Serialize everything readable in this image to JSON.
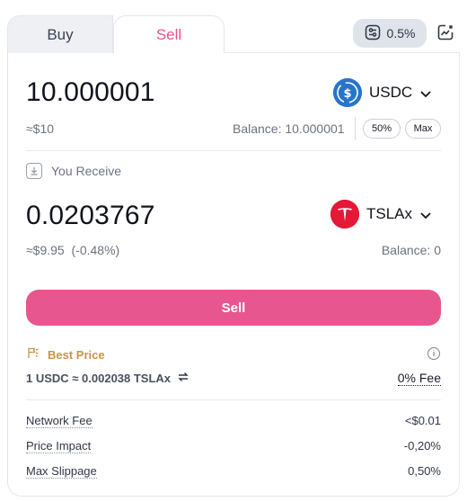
{
  "tabs": {
    "buy": "Buy",
    "sell": "Sell",
    "active": "sell"
  },
  "slippage": {
    "value": "0.5%"
  },
  "pay": {
    "amount": "10.000001",
    "usd_value": "≈$10",
    "balance": "Balance: 10.000001",
    "token": {
      "symbol": "USDC",
      "icon": "usdc-icon",
      "color": "#2775ca"
    },
    "pct_50": "50%",
    "max": "Max"
  },
  "receive": {
    "label": "You Receive",
    "amount": "0.0203767",
    "usd_value": "≈$9.95",
    "change": "(-0.48%)",
    "balance": "Balance: 0",
    "token": {
      "symbol": "TSLAx",
      "icon": "tesla-icon",
      "color": "#e31937"
    }
  },
  "action": {
    "label": "Sell",
    "color": "#e8568f"
  },
  "quote": {
    "best_price": "Best Price",
    "rate": "1 USDC ≈ 0.002038 TSLAx",
    "fee": "0% Fee"
  },
  "details": [
    {
      "label": "Network Fee",
      "value": "<$0.01"
    },
    {
      "label": "Price Impact",
      "value": "-0,20%"
    },
    {
      "label": "Max Slippage",
      "value": "0,50%"
    }
  ]
}
